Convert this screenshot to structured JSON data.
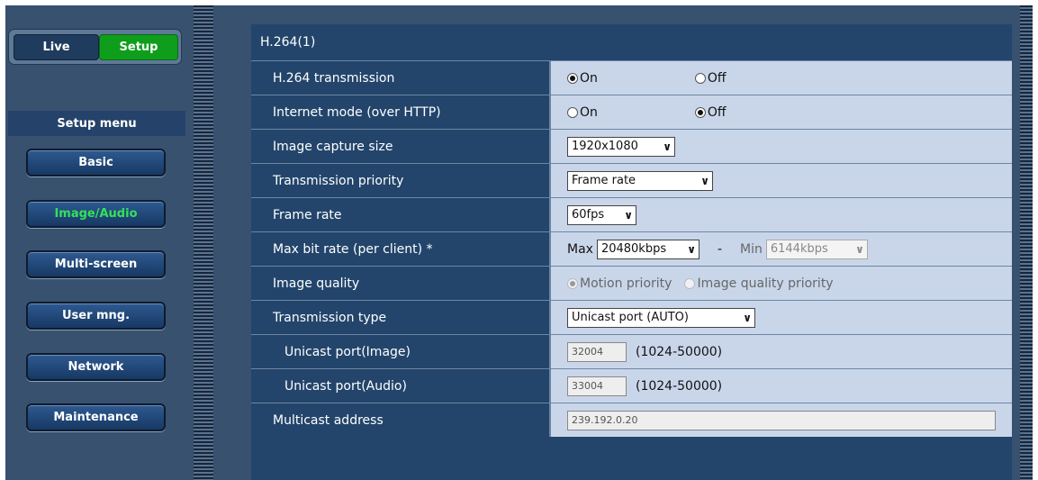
{
  "tabs": {
    "live": "Live",
    "setup": "Setup"
  },
  "sidebar": {
    "title": "Setup menu",
    "items": [
      {
        "label": "Basic"
      },
      {
        "label": "Image/Audio"
      },
      {
        "label": "Multi-screen"
      },
      {
        "label": "User mng."
      },
      {
        "label": "Network"
      },
      {
        "label": "Maintenance"
      }
    ]
  },
  "panel": {
    "title": "H.264(1)",
    "rows": {
      "h264_transmission": {
        "label": "H.264 transmission",
        "on": "On",
        "off": "Off",
        "selected": "On"
      },
      "internet_mode": {
        "label": "Internet mode (over HTTP)",
        "on": "On",
        "off": "Off",
        "selected": "Off"
      },
      "image_capture_size": {
        "label": "Image capture size",
        "value": "1920x1080"
      },
      "transmission_priority": {
        "label": "Transmission priority",
        "value": "Frame rate"
      },
      "frame_rate": {
        "label": "Frame rate",
        "value": "60fps"
      },
      "max_bit_rate": {
        "label": "Max bit rate (per client) *",
        "max_label": "Max",
        "max_value": "20480kbps",
        "separator": "-",
        "min_label": "Min",
        "min_value": "6144kbps"
      },
      "image_quality": {
        "label": "Image quality",
        "option1": "Motion priority",
        "option2": "Image quality priority",
        "selected": "Motion priority"
      },
      "transmission_type": {
        "label": "Transmission type",
        "value": "Unicast port (AUTO)"
      },
      "unicast_image": {
        "label": "Unicast port(Image)",
        "value": "32004",
        "range": "(1024-50000)"
      },
      "unicast_audio": {
        "label": "Unicast port(Audio)",
        "value": "33004",
        "range": "(1024-50000)"
      },
      "multicast_address": {
        "label": "Multicast address",
        "value": "239.192.0.20"
      }
    }
  },
  "colors": {
    "background": "#37516f",
    "panel": "#23456b",
    "value_cell": "#c9d6ea",
    "setup_tab": "#0f9e1c",
    "active_nav_text": "#34e05a"
  },
  "icons": {
    "dropdown": "chevron-down-icon",
    "radio": "radio-button-icon"
  }
}
